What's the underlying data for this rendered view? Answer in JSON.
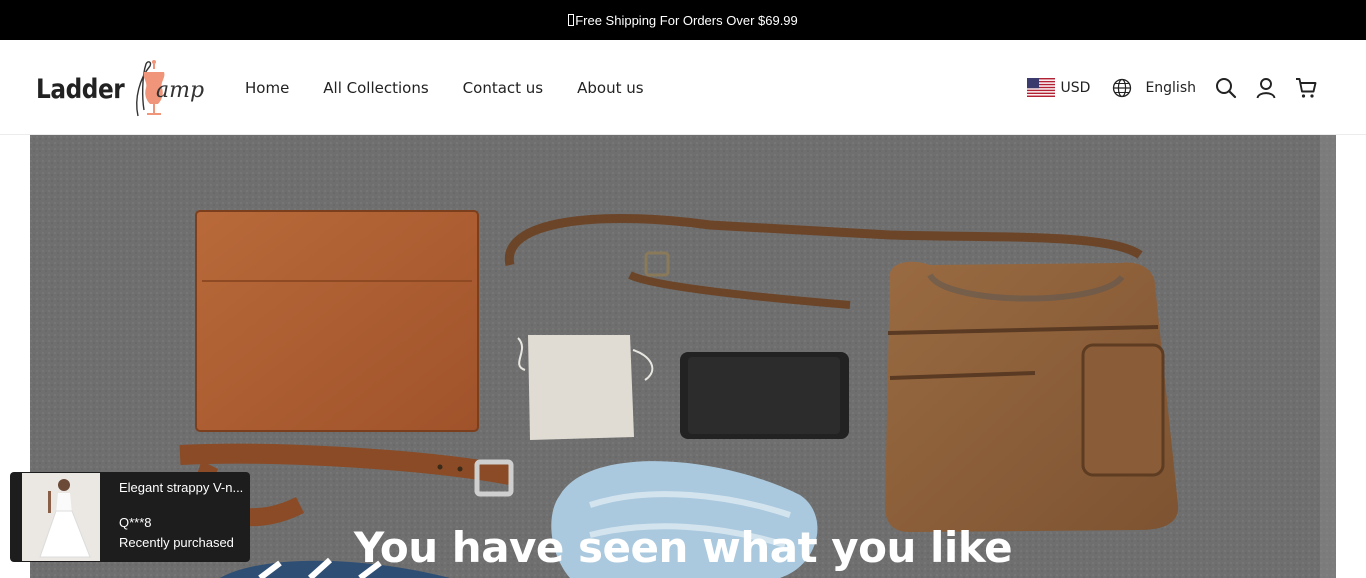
{
  "announcement": {
    "text": "Free Shipping For Orders Over $69.99"
  },
  "logo": {
    "word": "Ladder",
    "script": "amp"
  },
  "nav": {
    "items": [
      {
        "label": "Home"
      },
      {
        "label": "All Collections"
      },
      {
        "label": "Contact us"
      },
      {
        "label": "About us"
      }
    ]
  },
  "tools": {
    "currency": "USD",
    "language": "English",
    "icons": [
      "us-flag-icon",
      "globe-icon",
      "search-icon",
      "account-icon",
      "cart-icon"
    ]
  },
  "hero": {
    "title": "You have seen what you like"
  },
  "purchase_popup": {
    "product": "Elegant strappy V-n...",
    "buyer": "Q***8",
    "status": "Recently purchased"
  },
  "colors": {
    "announcement_bg": "#000000",
    "logo_accent": "#f0957a",
    "popup_bg": "#1d1d1d"
  }
}
